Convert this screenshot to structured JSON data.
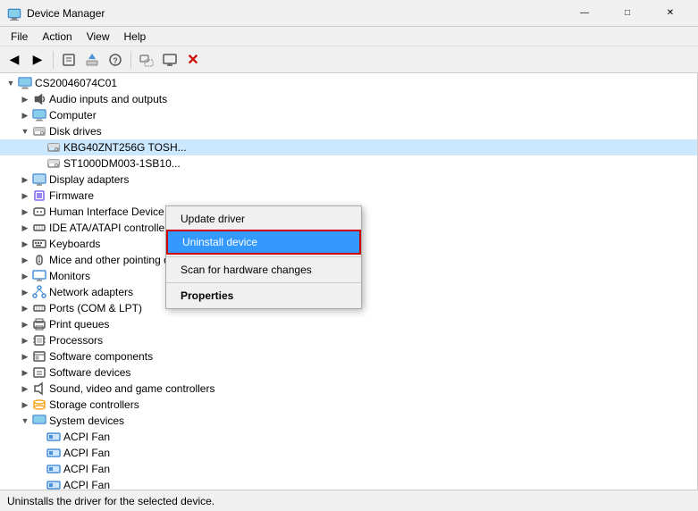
{
  "titleBar": {
    "title": "Device Manager",
    "minimize": "—",
    "maximize": "□",
    "close": "✕"
  },
  "menuBar": {
    "items": [
      "File",
      "Action",
      "View",
      "Help"
    ]
  },
  "toolbar": {
    "buttons": [
      "←",
      "→",
      "⊞",
      "⊟",
      "?",
      "⊡",
      "🖥",
      "⊗"
    ]
  },
  "tree": {
    "rootLabel": "CS20046074C01",
    "items": [
      {
        "indent": 1,
        "expanded": false,
        "label": "Audio inputs and outputs",
        "iconType": "sound"
      },
      {
        "indent": 1,
        "expanded": false,
        "label": "Computer",
        "iconType": "computer"
      },
      {
        "indent": 1,
        "expanded": true,
        "label": "Disk drives",
        "iconType": "disk"
      },
      {
        "indent": 2,
        "expanded": false,
        "label": "KBG40ZNT256G TOSH...",
        "iconType": "disk",
        "selected": true
      },
      {
        "indent": 2,
        "expanded": false,
        "label": "ST1000DM003-1SB10...",
        "iconType": "disk"
      },
      {
        "indent": 1,
        "expanded": false,
        "label": "Display adapters",
        "iconType": "monitor"
      },
      {
        "indent": 1,
        "expanded": false,
        "label": "Firmware",
        "iconType": "chip"
      },
      {
        "indent": 1,
        "expanded": false,
        "label": "Human Interface Device",
        "iconType": "device"
      },
      {
        "indent": 1,
        "expanded": false,
        "label": "IDE ATA/ATAPI controlle...",
        "iconType": "device"
      },
      {
        "indent": 1,
        "expanded": false,
        "label": "Keyboards",
        "iconType": "keyboard"
      },
      {
        "indent": 1,
        "expanded": false,
        "label": "Mice and other pointing devices",
        "iconType": "mouse"
      },
      {
        "indent": 1,
        "expanded": false,
        "label": "Monitors",
        "iconType": "monitor"
      },
      {
        "indent": 1,
        "expanded": false,
        "label": "Network adapters",
        "iconType": "network"
      },
      {
        "indent": 1,
        "expanded": false,
        "label": "Ports (COM & LPT)",
        "iconType": "port"
      },
      {
        "indent": 1,
        "expanded": false,
        "label": "Print queues",
        "iconType": "print"
      },
      {
        "indent": 1,
        "expanded": false,
        "label": "Processors",
        "iconType": "cpu"
      },
      {
        "indent": 1,
        "expanded": false,
        "label": "Software components",
        "iconType": "chip"
      },
      {
        "indent": 1,
        "expanded": false,
        "label": "Software devices",
        "iconType": "device"
      },
      {
        "indent": 1,
        "expanded": false,
        "label": "Sound, video and game controllers",
        "iconType": "sound"
      },
      {
        "indent": 1,
        "expanded": false,
        "label": "Storage controllers",
        "iconType": "storage"
      },
      {
        "indent": 1,
        "expanded": true,
        "label": "System devices",
        "iconType": "system"
      },
      {
        "indent": 2,
        "expanded": false,
        "label": "ACPI Fan",
        "iconType": "acpi"
      },
      {
        "indent": 2,
        "expanded": false,
        "label": "ACPI Fan",
        "iconType": "acpi"
      },
      {
        "indent": 2,
        "expanded": false,
        "label": "ACPI Fan",
        "iconType": "acpi"
      },
      {
        "indent": 2,
        "expanded": false,
        "label": "ACPI Fan",
        "iconType": "acpi"
      }
    ]
  },
  "contextMenu": {
    "items": [
      {
        "label": "Update driver",
        "type": "normal"
      },
      {
        "label": "Uninstall device",
        "type": "active"
      },
      {
        "separator": true
      },
      {
        "label": "Scan for hardware changes",
        "type": "normal"
      },
      {
        "separator": true
      },
      {
        "label": "Properties",
        "type": "bold"
      }
    ]
  },
  "statusBar": {
    "text": "Uninstalls the driver for the selected device."
  }
}
